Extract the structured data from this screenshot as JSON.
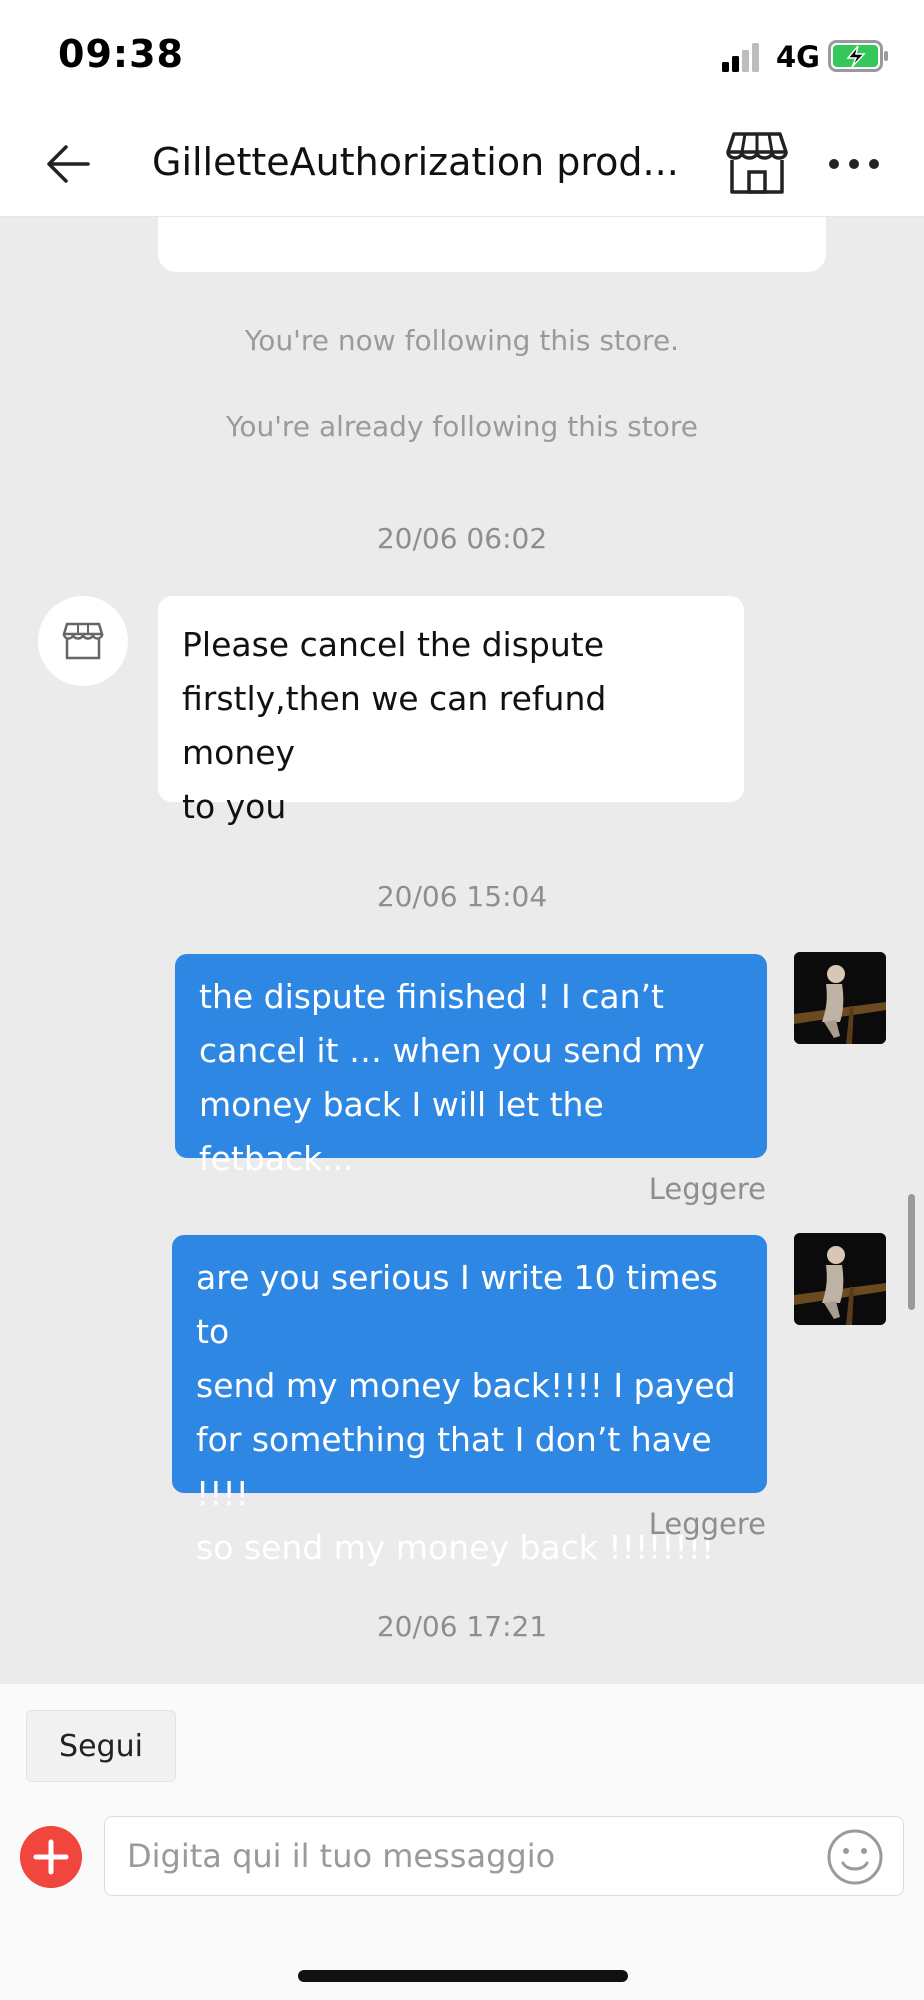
{
  "status_bar": {
    "time": "09:38",
    "network": "4G"
  },
  "header": {
    "title": "GilletteAuthorization prod..."
  },
  "chat": {
    "system_messages": [
      "You're now following this store.",
      "You're already following this store"
    ],
    "timestamps": [
      "20/06 06:02",
      "20/06 15:04",
      "20/06 17:21"
    ],
    "incoming": [
      {
        "lines": [
          "Please cancel the dispute",
          "firstly,then we can refund money",
          "to you"
        ]
      }
    ],
    "outgoing": [
      {
        "lines": [
          "the dispute finished ! I can’t",
          "cancel it … when you send my",
          "money back I will let the fetback..."
        ],
        "status": "Leggere"
      },
      {
        "lines": [
          "are you serious I write 10 times to",
          "send my money back!!!! I payed",
          "for something that I don’t have !!!!",
          "so send my money back !!!!!!!!"
        ],
        "status": "Leggere"
      }
    ]
  },
  "bottom": {
    "follow_label": "Segui",
    "input_placeholder": "Digita qui il tuo messaggio"
  },
  "colors": {
    "accent_blue": "#2f87e4",
    "accent_red": "#f1463e",
    "chat_background": "#ebebeb"
  }
}
